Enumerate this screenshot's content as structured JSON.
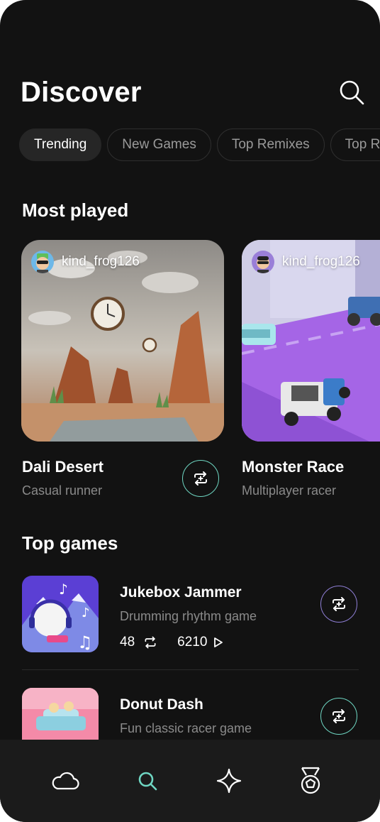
{
  "header": {
    "title": "Discover"
  },
  "chips": [
    "Trending",
    "New Games",
    "Top Remixes",
    "Top R"
  ],
  "most_played": {
    "title": "Most played",
    "cards": [
      {
        "creator": "kind_frog126",
        "name": "Dali Desert",
        "genre": "Casual runner"
      },
      {
        "creator": "kind_frog126",
        "name": "Monster Race",
        "genre": "Multiplayer racer"
      }
    ]
  },
  "top_games": {
    "title": "Top games",
    "items": [
      {
        "name": "Jukebox Jammer",
        "genre": "Drumming rhythm game",
        "remixes": "48",
        "plays": "6210"
      },
      {
        "name": "Donut Dash",
        "genre": "Fun classic racer game"
      }
    ]
  },
  "icons": {
    "search": "search-icon",
    "remix": "remix-icon",
    "play": "play-icon",
    "nav": [
      "cloud-icon",
      "search-icon",
      "sparkle-icon",
      "medal-icon"
    ]
  },
  "colors": {
    "background": "#121212",
    "accent_teal": "#6fd7c3",
    "accent_purple": "#8f7fd6",
    "nav_active": "#6fd7c3"
  }
}
